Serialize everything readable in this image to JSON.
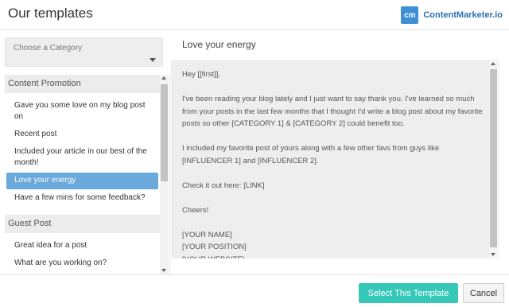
{
  "header": {
    "title": "Our templates",
    "brand_mark": "cm",
    "brand_name": "ContentMarketer.io"
  },
  "category_select": {
    "placeholder": "Choose a Category"
  },
  "categories": [
    {
      "name": "Content Promotion",
      "items": [
        "Gave you some love on my blog post on",
        "Recent post",
        "Included your article in our best of the month!",
        "Love your energy",
        "Have a few mins for some feedback?"
      ]
    },
    {
      "name": "Guest Post",
      "items": [
        "Great idea for a post",
        "What are you working on?"
      ]
    }
  ],
  "selected_item": "Love your energy",
  "template": {
    "title": "Love your energy",
    "body": "Hey [[first]],\n\nI've been reading your blog lately and I just want to say thank you. I've learned so much from your posts in the last few months that I thought I'd write a blog post about my favorite posts so other [CATEGORY 1] & [CATEGORY 2] could benefit too.\n\nI included my favorite post of yours along with a few other favs from guys like [INFLUENCER 1] and [INFLUENCER 2].\n\nCheck it out here: [LINK]\n\nCheers!\n\n[YOUR NAME]\n[YOUR POSITION]\n[YOUR WEBSITE]"
  },
  "footer": {
    "select_label": "Select This Template",
    "cancel_label": "Cancel"
  },
  "colors": {
    "selected": "#6aa9dc",
    "primary_button": "#35c8b8",
    "brand": "#2b6fb3"
  }
}
